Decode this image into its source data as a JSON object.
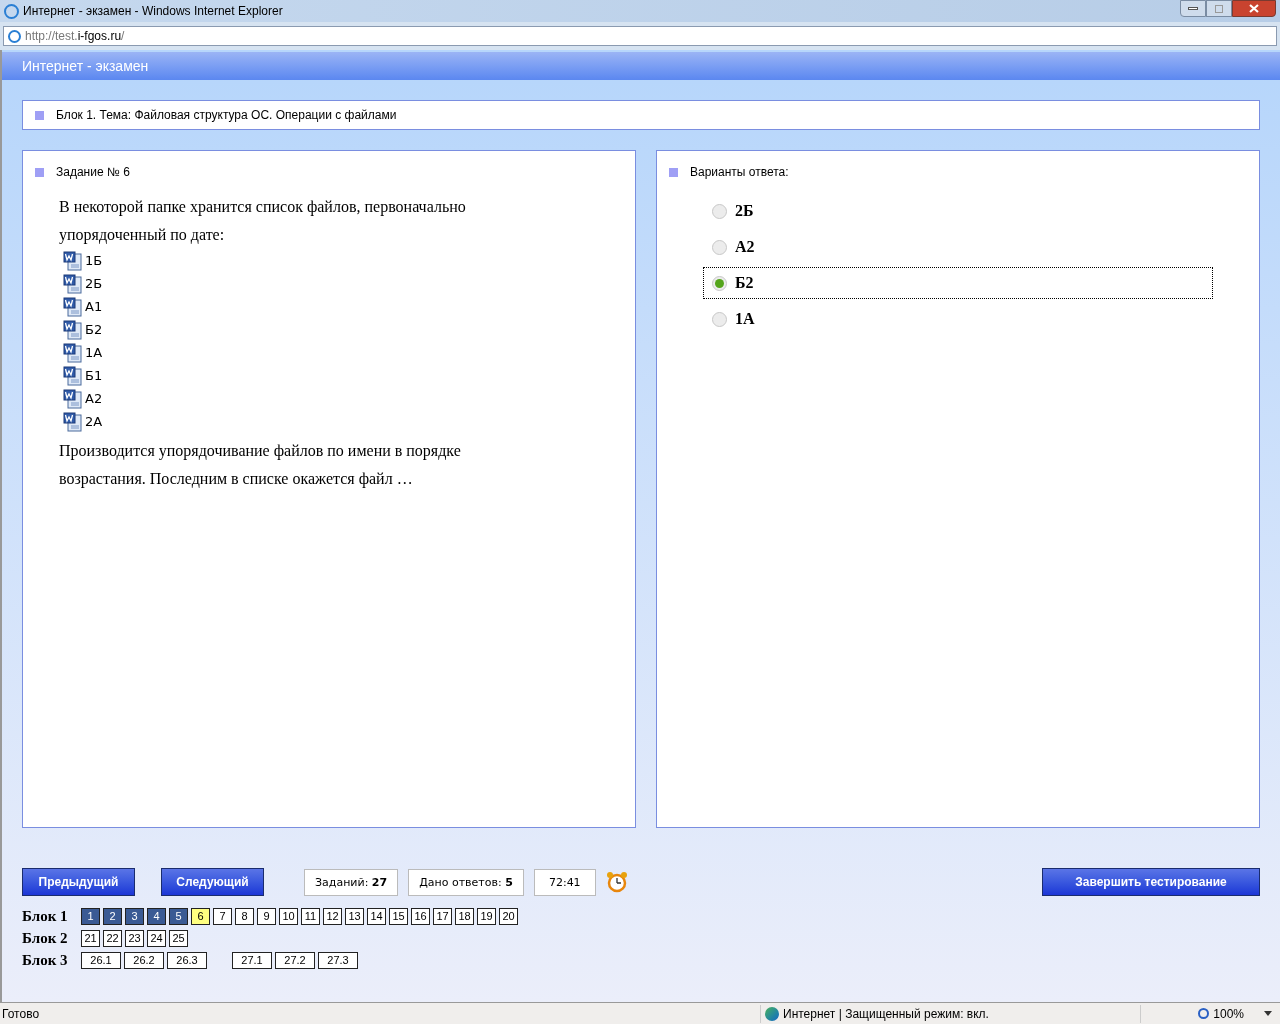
{
  "window": {
    "title": "Интернет - экзамен - Windows Internet Explorer"
  },
  "address": {
    "scheme": "http://test.",
    "domain": "i-fgos.ru",
    "suffix": "/"
  },
  "page_header": "Интернет - экзамен",
  "block_title": "Блок 1. Тема: Файловая структура ОС. Операции с файлами",
  "task": {
    "title": "Задание № 6",
    "intro": "В некоторой папке хранится список файлов, первоначально упорядоченный по дате:",
    "files": [
      "1Б",
      "2Б",
      "А1",
      "Б2",
      "1А",
      "Б1",
      "А2",
      "2А"
    ],
    "question": "Производится упорядочивание файлов по имени в порядке возрастания. Последним в списке окажется файл …"
  },
  "answers": {
    "title": "Варианты ответа:",
    "options": [
      {
        "label": "2Б",
        "selected": false
      },
      {
        "label": "А2",
        "selected": false
      },
      {
        "label": "Б2",
        "selected": true
      },
      {
        "label": "1А",
        "selected": false
      }
    ]
  },
  "nav": {
    "prev": "Предыдущий",
    "next": "Следующий",
    "counters": [
      "Заданий: **27**",
      "Дано ответов: **5**",
      "72:41"
    ],
    "finish": "Завершить тестирование"
  },
  "blocks": [
    {
      "label": "Блок 1",
      "groups": [
        [
          {
            "label": "1",
            "answered": true,
            "selected": false
          },
          {
            "label": "2",
            "answered": true,
            "selected": false
          },
          {
            "label": "3",
            "answered": true,
            "selected": false
          },
          {
            "label": "4",
            "answered": true,
            "selected": false
          },
          {
            "label": "5",
            "answered": true,
            "selected": false
          },
          {
            "label": "6",
            "answered": false,
            "selected": true
          },
          {
            "label": "7",
            "answered": false,
            "selected": false
          },
          {
            "label": "8",
            "answered": false,
            "selected": false
          },
          {
            "label": "9",
            "answered": false,
            "selected": false
          },
          {
            "label": "10",
            "answered": false,
            "selected": false
          },
          {
            "label": "11",
            "answered": false,
            "selected": false
          },
          {
            "label": "12",
            "answered": false,
            "selected": false
          },
          {
            "label": "13",
            "answered": false,
            "selected": false
          },
          {
            "label": "14",
            "answered": false,
            "selected": false
          },
          {
            "label": "15",
            "answered": false,
            "selected": false
          },
          {
            "label": "16",
            "answered": false,
            "selected": false
          },
          {
            "label": "17",
            "answered": false,
            "selected": false
          },
          {
            "label": "18",
            "answered": false,
            "selected": false
          },
          {
            "label": "19",
            "answered": false,
            "selected": false
          },
          {
            "label": "20",
            "answered": false,
            "selected": false
          }
        ]
      ]
    },
    {
      "label": "Блок 2",
      "groups": [
        [
          {
            "label": "21",
            "answered": false,
            "selected": false
          },
          {
            "label": "22",
            "answered": false,
            "selected": false
          },
          {
            "label": "23",
            "answered": false,
            "selected": false
          },
          {
            "label": "24",
            "answered": false,
            "selected": false
          },
          {
            "label": "25",
            "answered": false,
            "selected": false
          }
        ]
      ]
    },
    {
      "label": "Блок 3",
      "groups": [
        [
          {
            "label": "26.1",
            "answered": false,
            "selected": false
          },
          {
            "label": "26.2",
            "answered": false,
            "selected": false
          },
          {
            "label": "26.3",
            "answered": false,
            "selected": false
          }
        ],
        [
          {
            "label": "27.1",
            "answered": false,
            "selected": false
          },
          {
            "label": "27.2",
            "answered": false,
            "selected": false
          },
          {
            "label": "27.3",
            "answered": false,
            "selected": false
          }
        ]
      ]
    }
  ],
  "status_bar": {
    "text": "Готово",
    "zone": "Интернет | Защищенный режим: вкл.",
    "zoom": "100%"
  }
}
